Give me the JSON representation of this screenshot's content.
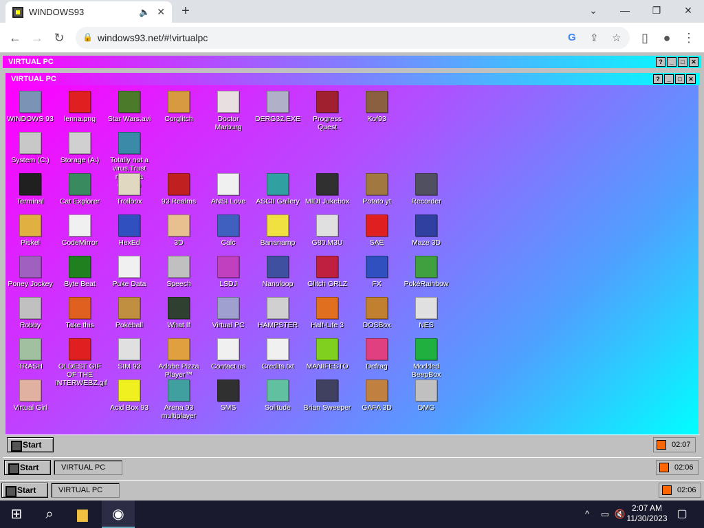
{
  "browser": {
    "tab_title": "WINDOWS93",
    "url": "windows93.net/#!virtualpc",
    "win_controls": {
      "minimize": "—",
      "restore": "❐",
      "close": "✕"
    }
  },
  "outer_window": {
    "title": "VIRTUAL PC"
  },
  "inner_window": {
    "title": "VIRTUAL PC"
  },
  "window_buttons": {
    "help": "?",
    "min": "_",
    "max": "□",
    "close": "✕"
  },
  "desktop": {
    "icons": [
      {
        "label": "WINDOWS 93",
        "color": "#7b93b5"
      },
      {
        "label": "lenna.png",
        "color": "#e02020"
      },
      {
        "label": "Star Wars.avi",
        "color": "#4a7a2a"
      },
      {
        "label": "Corglitch",
        "color": "#d89a40"
      },
      {
        "label": "Doctor Marburg",
        "color": "#e8e0e0"
      },
      {
        "label": "DERG32.EXE",
        "color": "#b0b0c8"
      },
      {
        "label": "Progress Quest",
        "color": "#a02030"
      },
      {
        "label": "Kof93",
        "color": "#8a6040"
      },
      {
        "label": "System (C:)",
        "color": "#c8c8c8"
      },
      {
        "label": "Storage (A:)",
        "color": "#d0d0d0"
      },
      {
        "label": "Totally not a virus.Trust me..im a dolphin",
        "color": "#3a8aa8"
      },
      {
        "label": "Terminal",
        "color": "#202020"
      },
      {
        "label": "Cat Explorer",
        "color": "#3a8a60"
      },
      {
        "label": "Trollbox",
        "color": "#e0d8c0"
      },
      {
        "label": "93 Realms",
        "color": "#c02020"
      },
      {
        "label": "ANSI Love",
        "color": "#f0f0f0"
      },
      {
        "label": "ASCII Gallery",
        "color": "#30a0a0"
      },
      {
        "label": "MIDI Jukebox",
        "color": "#303030"
      },
      {
        "label": "Potato.yt",
        "color": "#a07840"
      },
      {
        "label": "Recorder",
        "color": "#505060"
      },
      {
        "label": "Piskel",
        "color": "#e0b040"
      },
      {
        "label": "CodeMirror",
        "color": "#f0f0f0"
      },
      {
        "label": "HexEd",
        "color": "#3050c0"
      },
      {
        "label": "3D",
        "color": "#e8c090"
      },
      {
        "label": "Calc",
        "color": "#4060c0"
      },
      {
        "label": "Bananamp",
        "color": "#f0e040"
      },
      {
        "label": "G80.M3U",
        "color": "#e0e0e0"
      },
      {
        "label": "SAE",
        "color": "#e02020"
      },
      {
        "label": "Maze 3D",
        "color": "#3040a0"
      },
      {
        "label": "Poney Jockey",
        "color": "#a060c0"
      },
      {
        "label": "Byte Beat",
        "color": "#208020"
      },
      {
        "label": "Puke Data",
        "color": "#f0f0f0"
      },
      {
        "label": "Speech",
        "color": "#c0c0c0"
      },
      {
        "label": "LSDJ",
        "color": "#c040c0"
      },
      {
        "label": "Nanoloop",
        "color": "#4050a0"
      },
      {
        "label": "Glitch GRLZ",
        "color": "#c02040"
      },
      {
        "label": "FX",
        "color": "#3050c0"
      },
      {
        "label": "PokéRainbow",
        "color": "#40a040"
      },
      {
        "label": "Robby",
        "color": "#c0c0c0"
      },
      {
        "label": "Take this",
        "color": "#e06020"
      },
      {
        "label": "Pokéball",
        "color": "#c09040"
      },
      {
        "label": "What If",
        "color": "#304030"
      },
      {
        "label": "Virtual PC",
        "color": "#a0a0d0"
      },
      {
        "label": "HAMPSTER",
        "color": "#d0d0d0"
      },
      {
        "label": "Half-Life 3",
        "color": "#e07020"
      },
      {
        "label": "DOSBox",
        "color": "#c08030"
      },
      {
        "label": "NES",
        "color": "#e0e0e0"
      },
      {
        "label": "TRASH",
        "color": "#a0c0a0"
      },
      {
        "label": "OLDEST GIF OF THE INTERWEBZ.gif",
        "color": "#e02020"
      },
      {
        "label": "SIM 93",
        "color": "#e0e0e0"
      },
      {
        "label": "Adobe Pizza Player™",
        "color": "#e0a040"
      },
      {
        "label": "Contact us",
        "color": "#f0f0f0"
      },
      {
        "label": "Credits.txt",
        "color": "#f0f0f0"
      },
      {
        "label": "MANIFESTO",
        "color": "#80d020"
      },
      {
        "label": "Defrag",
        "color": "#e04080"
      },
      {
        "label": "Modded BeepBox",
        "color": "#20b040"
      },
      {
        "label": "Virtual Girl",
        "color": "#e0b0a0"
      },
      {
        "label": "Acid Box 93",
        "color": "#f0f020"
      },
      {
        "label": "Arena 93 multiplayer",
        "color": "#40a0a0"
      },
      {
        "label": "SMS",
        "color": "#303030"
      },
      {
        "label": "Solitude",
        "color": "#60c0a0"
      },
      {
        "label": "Brian Sweeper",
        "color": "#404060"
      },
      {
        "label": "GAFA 3D",
        "color": "#c08040"
      },
      {
        "label": "DMG",
        "color": "#c0c0c0"
      }
    ]
  },
  "taskbars": [
    {
      "start": "Start",
      "item": "",
      "time": "02:07"
    },
    {
      "start": "Start",
      "item": "VIRTUAL PC",
      "time": "02:06"
    },
    {
      "start": "Start",
      "item": "VIRTUAL PC",
      "time": "02:06"
    }
  ],
  "windows_taskbar": {
    "time": "2:07 AM",
    "date": "11/30/2023"
  }
}
